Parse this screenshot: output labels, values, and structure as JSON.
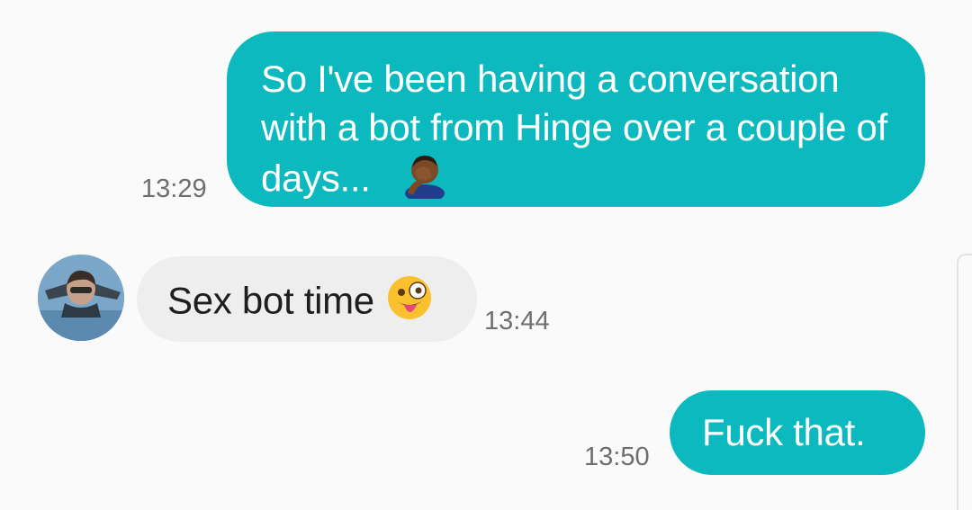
{
  "conversation": {
    "messages": [
      {
        "direction": "sent",
        "text": "So I've been having a conversation with a bot from Hinge over a couple of days...",
        "emoji": "person-facepalming-medium-dark-skin",
        "time": "13:29"
      },
      {
        "direction": "received",
        "text": "Sex bot time",
        "emoji": "zany-face",
        "time": "13:44"
      },
      {
        "direction": "sent",
        "text": "Fuck that.",
        "time": "13:50"
      }
    ]
  },
  "colors": {
    "sent_bubble": "#0cb9bf",
    "received_bubble": "#eeeeee",
    "background": "#fafafa",
    "timestamp": "#6e6e6e"
  }
}
